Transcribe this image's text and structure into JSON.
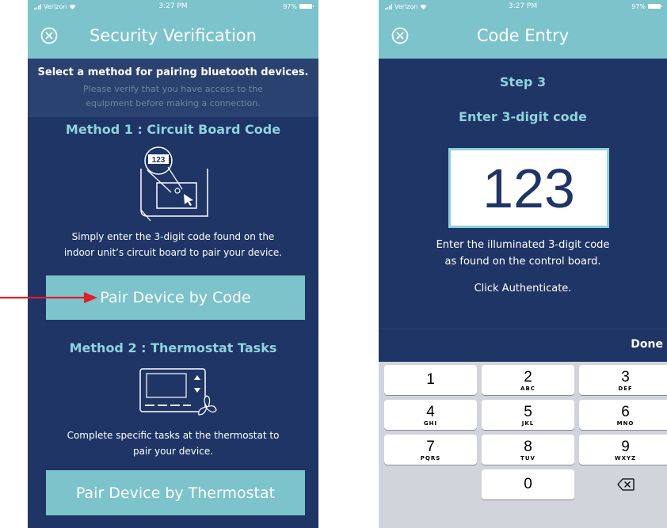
{
  "left_screen": {
    "status": {
      "carrier": "Verizon",
      "time": "3:27 PM",
      "battery": "97%"
    },
    "title": "Security Verification",
    "intro": {
      "heading": "Select a method for pairing bluetooth devices.",
      "note_line1": "Please verify that you have access to the",
      "note_line2": "equipment before making a connection."
    },
    "method1": {
      "title": "Method 1 : Circuit Board Code",
      "illustration_code": "123",
      "desc_line1": "Simply enter the 3-digit code found on the",
      "desc_line2": "indoor unit’s circuit board to pair your device.",
      "button": "Pair Device by Code"
    },
    "method2": {
      "title": "Method 2 : Thermostat Tasks",
      "desc_line1": "Complete specific tasks at the thermostat to",
      "desc_line2": "pair your device.",
      "button": "Pair Device by Thermostat"
    }
  },
  "right_screen": {
    "status": {
      "carrier": "Verizon",
      "time": "3:27 PM",
      "battery": "97%"
    },
    "title": "Code Entry",
    "step": "Step 3",
    "subtitle": "Enter 3-digit code",
    "code": "123",
    "instr_line1": "Enter the illuminated 3-digit code",
    "instr_line2": "as found on the control board.",
    "instr_line3": "Click Authenticate.",
    "done": "Done",
    "keys": [
      {
        "num": "1",
        "letters": ""
      },
      {
        "num": "2",
        "letters": "ABC"
      },
      {
        "num": "3",
        "letters": "DEF"
      },
      {
        "num": "4",
        "letters": "GHI"
      },
      {
        "num": "5",
        "letters": "JKL"
      },
      {
        "num": "6",
        "letters": "MNO"
      },
      {
        "num": "7",
        "letters": "PQRS"
      },
      {
        "num": "8",
        "letters": "TUV"
      },
      {
        "num": "9",
        "letters": "WXYZ"
      },
      {
        "num": "0",
        "letters": ""
      }
    ]
  },
  "icons": [
    "close-icon",
    "signal-icon",
    "wifi-icon",
    "battery-icon",
    "backspace-icon",
    "red-arrow-icon",
    "fan-icon"
  ],
  "colors": {
    "nav": "#7cc3cc",
    "background": "#1f3566",
    "accent_text": "#8fd2dd",
    "arrow": "#e31e24"
  }
}
